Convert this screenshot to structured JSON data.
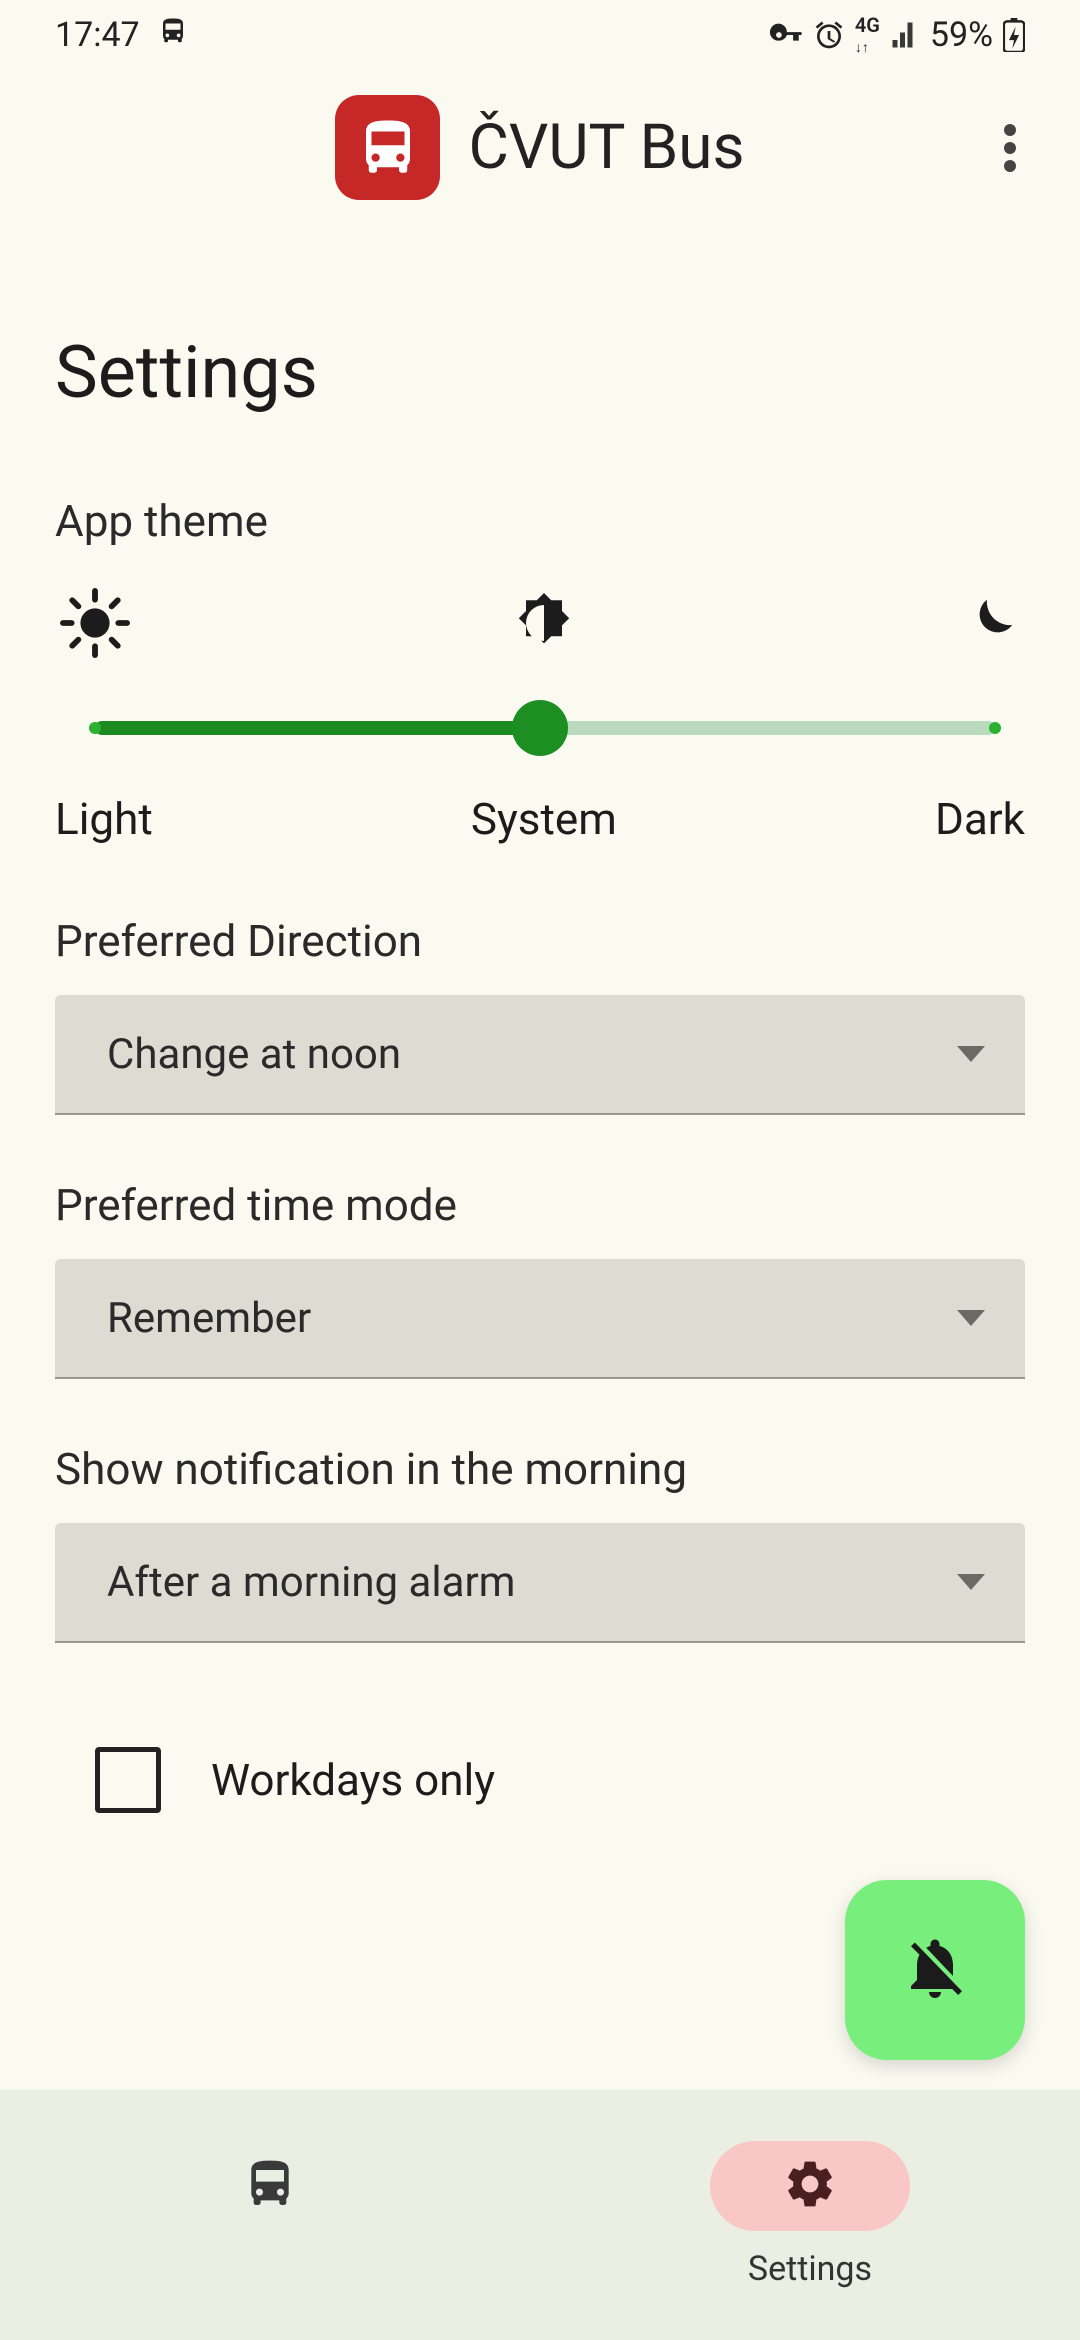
{
  "status": {
    "time": "17:47",
    "battery": "59%"
  },
  "app": {
    "title": "ČVUT Bus"
  },
  "page": {
    "title": "Settings"
  },
  "theme": {
    "label": "App theme",
    "options": {
      "light": "Light",
      "system": "System",
      "dark": "Dark"
    },
    "selected": "System"
  },
  "direction": {
    "label": "Preferred Direction",
    "value": "Change at noon"
  },
  "timemode": {
    "label": "Preferred time mode",
    "value": "Remember"
  },
  "notification": {
    "label": "Show notification in the morning",
    "value": "After a morning alarm"
  },
  "workdays": {
    "label": "Workdays only",
    "checked": false
  },
  "nav": {
    "settings": "Settings"
  }
}
